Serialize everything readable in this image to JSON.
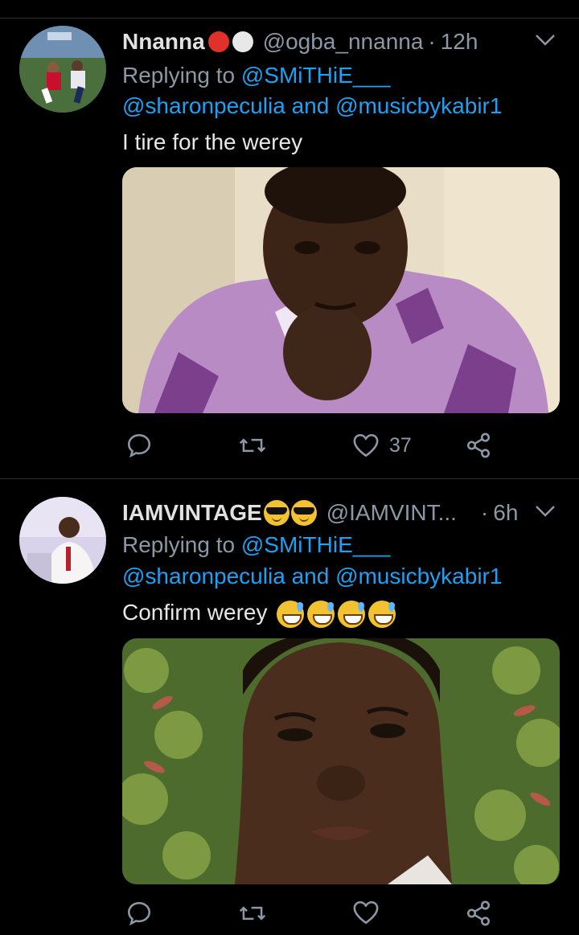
{
  "tweets": [
    {
      "name": "Nnanna",
      "handle": "@ogba_nnanna",
      "separator": "·",
      "time": "12h",
      "replying_prefix": "Replying to",
      "replying_to_1": "@SMiTHiE___",
      "mention_a": "@sharonpeculia",
      "and_word": "and",
      "mention_b": "@musicbykabir1",
      "text": "I tire for the werey",
      "name_emojis": [
        "red-circle",
        "white-circle"
      ],
      "likes": "37",
      "retweets": "",
      "replies": ""
    },
    {
      "name": "IAMVINTAGE",
      "handle": "@IAMVINT...",
      "separator": "·",
      "time": "6h",
      "replying_prefix": "Replying to",
      "replying_to_1": "@SMiTHiE___",
      "mention_a": "@sharonpeculia",
      "and_word": "and",
      "mention_b": "@musicbykabir1",
      "text": "Confirm werey",
      "name_emojis": [
        "sunglasses-face",
        "sunglasses-face"
      ],
      "text_emojis": [
        "grinning-sweat-face",
        "grinning-sweat-face",
        "grinning-sweat-face",
        "grinning-sweat-face"
      ]
    }
  ],
  "colors": {
    "background": "#000000",
    "link": "#1da1f2",
    "muted": "#8b98a5",
    "divider": "#2f3336"
  }
}
